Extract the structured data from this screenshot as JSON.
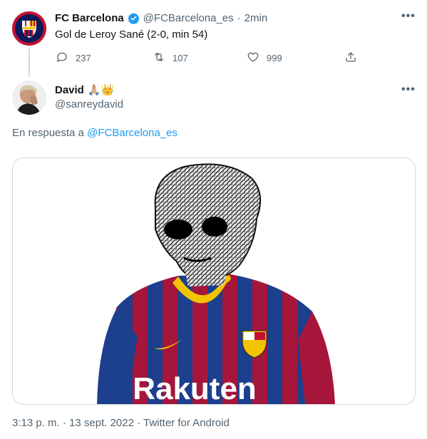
{
  "parent_tweet": {
    "author_name": "FC Barcelona",
    "handle": "@FCBarcelona_es",
    "separator": "·",
    "time_ago": "2min",
    "text": "Gol de Leroy Sané (2-0, min 54)",
    "replies": "237",
    "retweets": "107",
    "likes": "999",
    "verified_color": "#1d9bf0"
  },
  "reply_tweet": {
    "author_name": "David",
    "name_emojis": "🙏🏼👑",
    "handle": "@sanreydavid",
    "in_reply_prefix": "En respuesta a",
    "in_reply_handle": "@FCBarcelona_es"
  },
  "footer": {
    "timestamp": "3:13 p. m. · 13 sept. 2022 · Twitter for Android"
  },
  "icons": {
    "more": "more-options-icon",
    "reply": "reply-icon",
    "retweet": "retweet-icon",
    "like": "heart-icon",
    "share": "share-icon"
  },
  "colors": {
    "accent": "#1d9bf0",
    "text": "#0f1419",
    "muted": "#536471",
    "border": "#cfd9de"
  }
}
